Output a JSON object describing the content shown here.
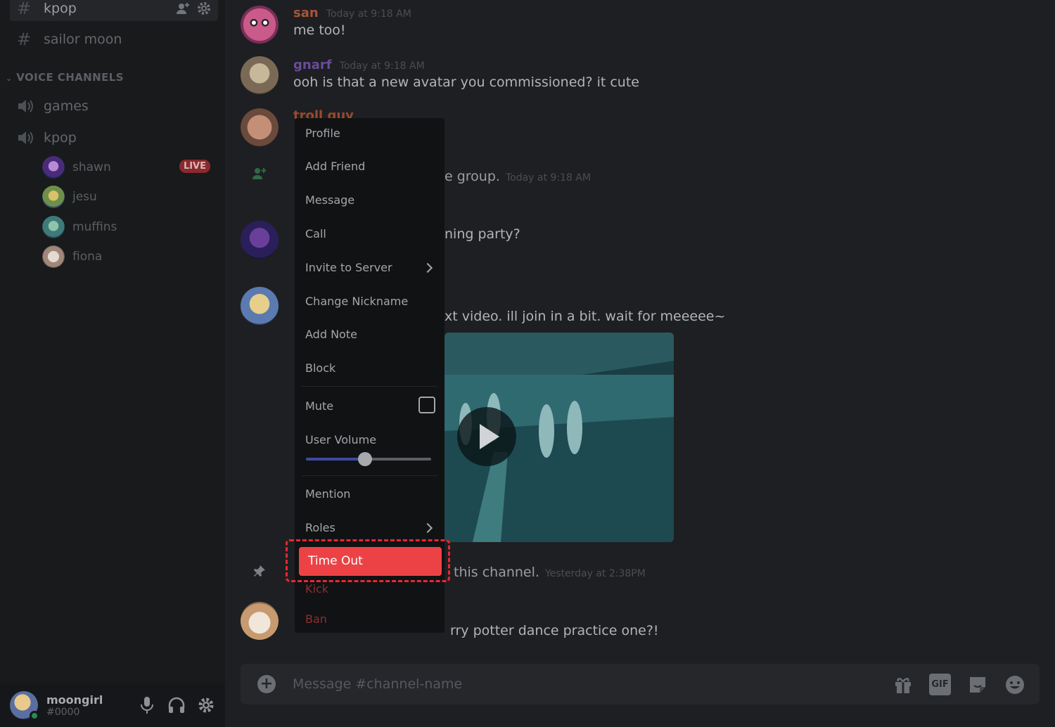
{
  "sidebar": {
    "text_channels": [
      {
        "name": "kpop",
        "active": true
      },
      {
        "name": "sailor moon",
        "active": false
      }
    ],
    "voice_section_label": "VOICE CHANNELS",
    "voice_channels": [
      {
        "name": "games"
      },
      {
        "name": "kpop"
      }
    ],
    "voice_users": [
      {
        "name": "shawn",
        "badge": "LIVE"
      },
      {
        "name": "jesu",
        "badge": ""
      },
      {
        "name": "muffins",
        "badge": ""
      },
      {
        "name": "fiona",
        "badge": ""
      }
    ]
  },
  "user_panel": {
    "username": "moongirl",
    "tag": "#0000",
    "controls": [
      "microphone-icon",
      "headphones-icon",
      "settings-icon"
    ]
  },
  "messages": [
    {
      "author": "san",
      "time": "Today at 9:18 AM",
      "text": "me too!",
      "author_color": "#a8553a"
    },
    {
      "author": "gnarf",
      "time": "Today at 9:18 AM",
      "text": "ooh is that a new avatar you commissioned? it cute",
      "author_color": "#6a4b9a"
    },
    {
      "author": "troll guy",
      "time": "Today at 9:18 AM",
      "text": "",
      "author_color": "#9a4a2c"
    }
  ],
  "partial_lines": {
    "group_join": {
      "text": "e group.",
      "time": "Today at 9:18 AM"
    },
    "party": {
      "text": "ning party?"
    },
    "video_msg": {
      "text": "xt video. ill join in a bit. wait for meeeee~"
    },
    "pinned": {
      "text": "this channel.",
      "time": "Yesterday at 2:38PM"
    },
    "last_msg": {
      "text": "rry potter dance practice one?!"
    }
  },
  "composer": {
    "placeholder": "Message #channel-name",
    "gif_label": "GIF",
    "tools": [
      "gift-icon",
      "gif-icon",
      "sticker-icon",
      "emoji-icon"
    ]
  },
  "context_menu": {
    "items": [
      {
        "label": "Profile"
      },
      {
        "label": "Add Friend"
      },
      {
        "label": "Message"
      },
      {
        "label": "Call"
      },
      {
        "label": "Invite to Server",
        "submenu": true
      },
      {
        "label": "Change Nickname"
      },
      {
        "label": "Add Note"
      },
      {
        "label": "Block"
      }
    ],
    "mute_label": "Mute",
    "mute_checked": false,
    "volume_label": "User Volume",
    "volume_fraction": 0.47,
    "mention_label": "Mention",
    "roles_label": "Roles",
    "timeout_label": "Time Out",
    "kick_label": "Kick",
    "ban_label": "Ban"
  },
  "colors": {
    "accent_blurple": "#5865f2",
    "danger_red": "#ed4245",
    "highlight_outline": "#e82832"
  }
}
